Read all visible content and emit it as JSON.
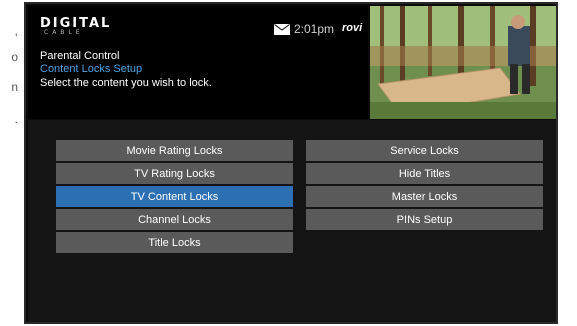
{
  "header": {
    "logo_main": "DIGITAL",
    "logo_sub": "CABLE",
    "time": "2:01pm",
    "provider": "rovi",
    "breadcrumb_title": "Parental Control",
    "breadcrumb_subtitle": "Content Locks Setup",
    "instruction": "Select the content you wish to lock."
  },
  "margin_text": [
    ",",
    "o",
    "n",
    "."
  ],
  "menu": {
    "left": [
      {
        "label": "Movie Rating Locks",
        "selected": false
      },
      {
        "label": "TV Rating Locks",
        "selected": false
      },
      {
        "label": "TV Content Locks",
        "selected": true
      },
      {
        "label": "Channel Locks",
        "selected": false
      },
      {
        "label": "Title Locks",
        "selected": false
      }
    ],
    "right": [
      {
        "label": "Service Locks",
        "selected": false
      },
      {
        "label": "Hide Titles",
        "selected": false
      },
      {
        "label": "Master Locks",
        "selected": false
      },
      {
        "label": "PINs Setup",
        "selected": false
      }
    ]
  },
  "colors": {
    "selected": "#2c6fb3",
    "button": "#5a5a5a",
    "subtitle": "#4fa3e0"
  },
  "icons": {
    "mail": "envelope-icon"
  }
}
